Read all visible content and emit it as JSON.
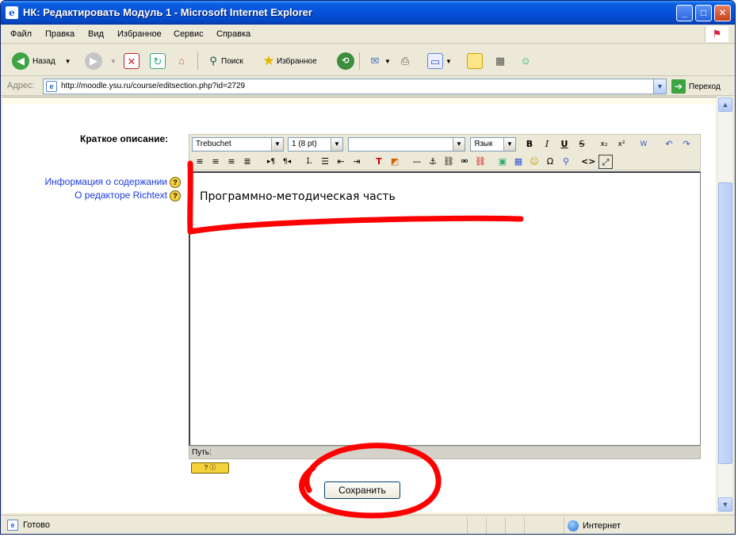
{
  "window": {
    "title": "НК: Редактировать Модуль 1 - Microsoft Internet Explorer",
    "minimize": "_",
    "maximize": "□",
    "close": "✕"
  },
  "menu": [
    "Файл",
    "Правка",
    "Вид",
    "Избранное",
    "Сервис",
    "Справка"
  ],
  "toolbar": {
    "back": "Назад",
    "search": "Поиск",
    "favorites": "Избранное"
  },
  "address": {
    "label": "Адрес:",
    "url": "http://moodle.ysu.ru/course/editsection.php?id=2729",
    "go": "Переход"
  },
  "form": {
    "description_label": "Краткое описание:",
    "help_info": "Информация о содержании",
    "help_editor": "О редакторе Richtext",
    "font_select": "Trebuchet",
    "size_select": "1 (8 pt)",
    "format_select": "",
    "lang_select": "Язык",
    "editor_content": "Программно-методическая часть",
    "path_label": "Путь:",
    "save_button": "Сохранить"
  },
  "status": {
    "text": "Готово",
    "zone": "Интернет"
  },
  "colors": {
    "titlebar": "#0551d9",
    "annotation": "#ff0000",
    "link": "#1a3ae0"
  }
}
